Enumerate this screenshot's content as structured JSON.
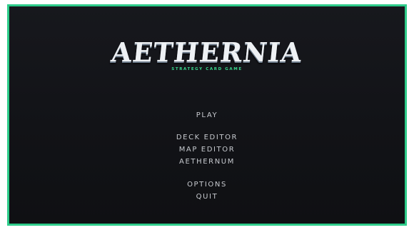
{
  "game": {
    "title": "AETHERNIA",
    "subtitle": "STRATEGY CARD GAME"
  },
  "menu": {
    "play": "PLAY",
    "deck_editor": "DECK EDITOR",
    "map_editor": "MAP EDITOR",
    "aethernum": "AETHERNUM",
    "options": "OPTIONS",
    "quit": "QUIT"
  },
  "colors": {
    "frame_border": "#2ecc8a",
    "background": "#131418",
    "subtitle_accent": "#39d98f",
    "menu_text": "#c7cacf"
  }
}
